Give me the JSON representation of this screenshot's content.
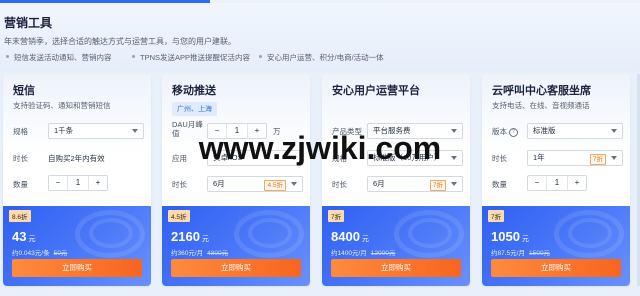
{
  "header": {
    "title": "营销工具",
    "subtitle": "年末营销季，选择合适的触达方式与运营工具，与您的用户建联。",
    "bullets": [
      "短信发送活动通知、营销内容",
      "TPNS发送APP推送提醒促活内容",
      "安心用户运营、积分/电商/活动一体"
    ]
  },
  "cards": [
    {
      "name": "短信",
      "desc": "支持验证码、通知和营销短信",
      "rows": {
        "spec_label": "规格",
        "spec_value": "1千条",
        "duration_label": "时长",
        "duration_value": "自购买2年内有效",
        "qty_label": "数量",
        "qty_value": "1"
      },
      "discount_tag": "8.6折",
      "price": "43",
      "price_unit": "元",
      "unit_price": "约0.043元/条",
      "original_price": "50元",
      "buy_label": "立即购买"
    },
    {
      "name": "移动推送",
      "region_tag": "广州、上海",
      "rows": {
        "dau_label": "DAU月峰值",
        "dau_value": "1",
        "dau_unit": "万",
        "app_label": "应用",
        "app_value": "安卓/iOS",
        "duration_label": "时长",
        "duration_value": "6月",
        "duration_discount": "4.5折"
      },
      "discount_tag": "4.5折",
      "price": "2160",
      "price_unit": "元",
      "unit_price": "约360元/月",
      "original_price": "4800元",
      "buy_label": "立即购买"
    },
    {
      "name": "安心用户运营平台",
      "rows": {
        "type_label": "产品类型",
        "type_value": "平台服务费",
        "spec_label": "规格",
        "spec_value": "标准版（10万用户）",
        "duration_label": "时长",
        "duration_value": "6月",
        "duration_discount": "7折"
      },
      "discount_tag": "7折",
      "price": "8400",
      "price_unit": "元",
      "unit_price": "约1400元/月",
      "original_price": "12000元",
      "buy_label": "立即购买"
    },
    {
      "name": "云呼叫中心客服坐席",
      "desc": "支持电话、在线、音视频通话",
      "rows": {
        "edition_label": "版本",
        "edition_value": "标准版",
        "duration_label": "时长",
        "duration_value": "1年",
        "duration_discount": "7折",
        "qty_label": "数量",
        "qty_value": "1"
      },
      "discount_tag": "7折",
      "price": "1050",
      "price_unit": "元",
      "unit_price": "约87.5元/月",
      "original_price": "1500元",
      "buy_label": "立即购买"
    }
  ],
  "watermark": "www.zjwiki.com",
  "colors": {
    "accent": "#2f6cf6",
    "buy": "#f7651f",
    "discount": "#e5771d"
  }
}
